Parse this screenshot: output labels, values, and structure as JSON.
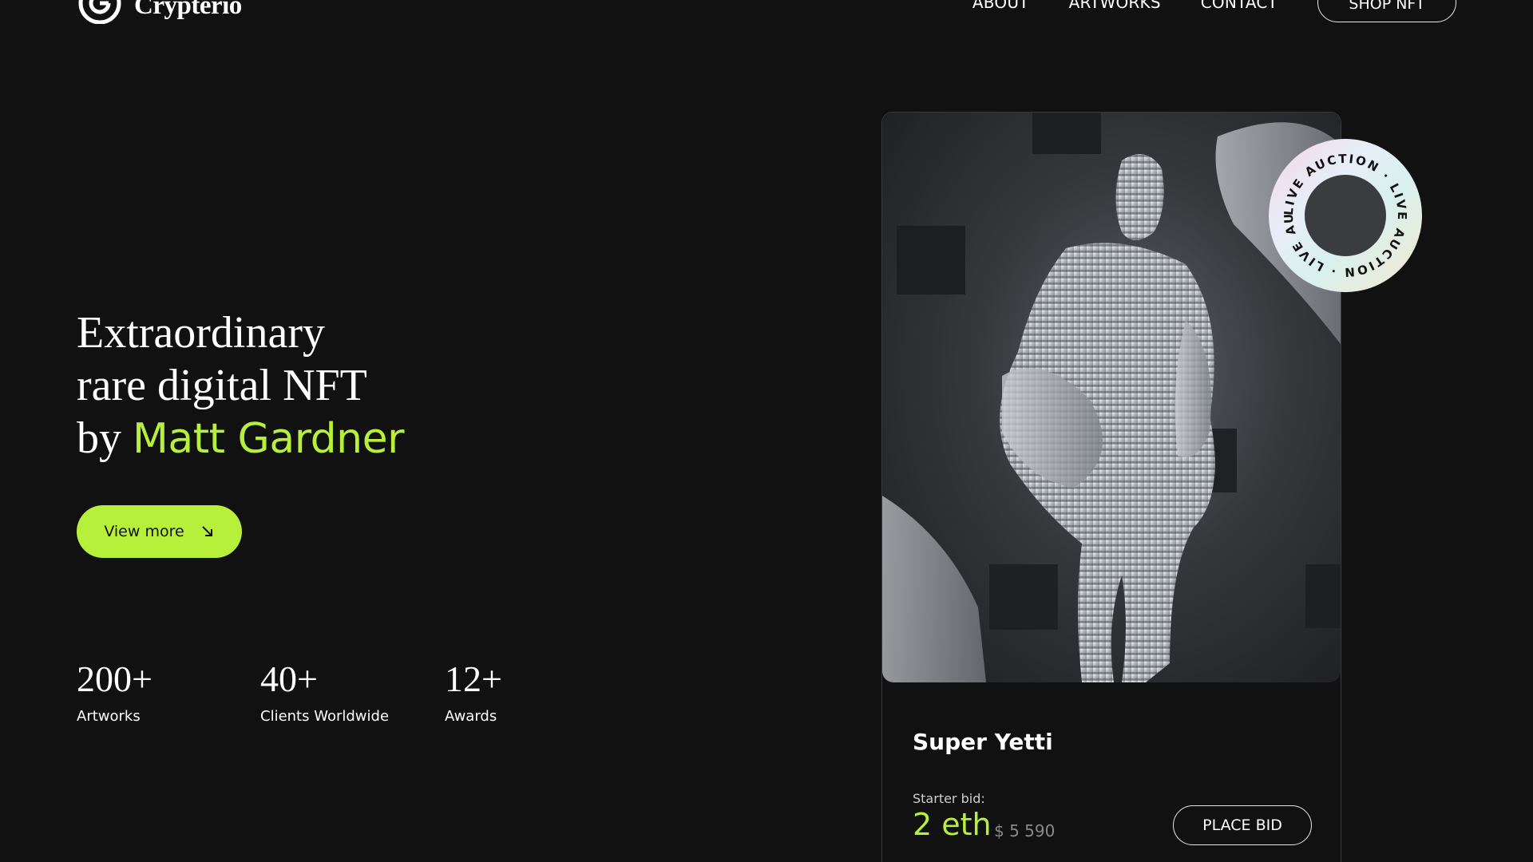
{
  "brand": {
    "name": "Crypterio"
  },
  "nav": {
    "links": [
      "ABOUT",
      "ARTWORKS",
      "CONTACT"
    ],
    "cta": "SHOP NFT"
  },
  "hero": {
    "line1": "Extraordinary",
    "line2": "rare digital NFT",
    "line3_prefix": "by",
    "artist": "Matt Gardner",
    "button": "View more"
  },
  "stats": [
    {
      "value": "200+",
      "label": "Artworks"
    },
    {
      "value": "40+",
      "label": "Clients Worldwide"
    },
    {
      "value": "12+",
      "label": "Awards"
    }
  ],
  "card": {
    "title": "Super Yetti",
    "bid_label": "Starter bid:",
    "bid_eth": "2 eth",
    "bid_usd": "$ 5 590",
    "button": "PLACE BID",
    "badge_text": "LIVE AUCTION · LIVE AUCTION · LIVE AUCTION ·"
  },
  "colors": {
    "background": "#111111",
    "accent": "#b6f03a",
    "text": "#ffffff"
  },
  "icons": {
    "logo": "crypterio-logo-icon",
    "view_more": "arrow-down-right-icon"
  }
}
